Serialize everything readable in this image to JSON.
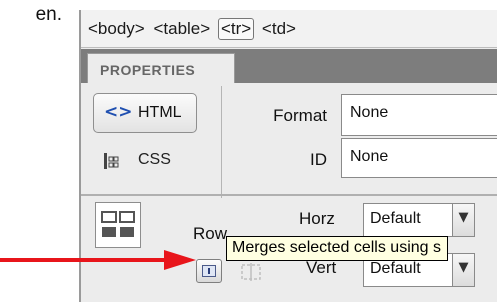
{
  "document": {
    "text": "en."
  },
  "tag_selector": {
    "tags": [
      "<body>",
      "<table>",
      "<tr>",
      "<td>"
    ],
    "active_tag": "<tr>"
  },
  "properties_panel": {
    "tab_label": "PROPERTIES",
    "html_button_label": "HTML",
    "css_button_label": "CSS",
    "format": {
      "label": "Format",
      "value": "None"
    },
    "id": {
      "label": "ID",
      "value": "None"
    }
  },
  "row_section": {
    "row_label": "Row",
    "horz": {
      "label": "Horz",
      "value": "Default"
    },
    "vert": {
      "label": "Vert",
      "value": "Default"
    },
    "tooltip_text": "Merges selected cells using s"
  },
  "icons": {
    "html": "code-angle-brackets-icon",
    "css": "css-grid-icon",
    "cell": "table-cell-icon",
    "merge": "merge-cells-icon",
    "split": "split-cells-icon",
    "arrow": "red-arrow-annotation"
  },
  "colors": {
    "tab_strip": "#7d7d7d",
    "tooltip_bg": "#ffffe1",
    "arrow": "#e8151b",
    "html_icon": "#1f4fb0"
  }
}
